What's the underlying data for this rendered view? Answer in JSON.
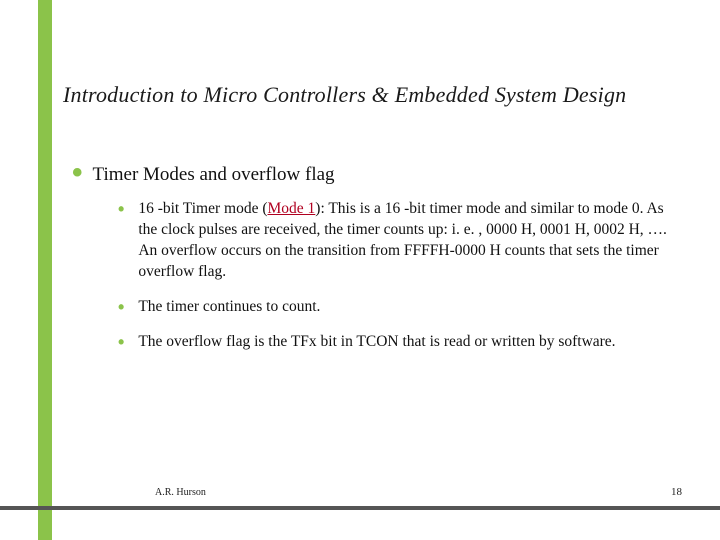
{
  "title": "Introduction to Micro Controllers & Embedded System Design",
  "main_bullet": "Timer Modes and overflow flag",
  "sub_bullets": {
    "b1_prefix": "16 -bit Timer mode (",
    "b1_mode": "Mode 1",
    "b1_suffix": "): This is a 16 -bit timer mode and similar to mode 0.  As the clock pulses are received, the timer counts up:  i. e. , 0000 H, 0001 H, 0002 H, ….  An overflow occurs on the transition from FFFFH-0000 H counts that sets the timer overflow flag.",
    "b2": "The timer continues to count.",
    "b3": "The overflow flag is the TFx bit in TCON that is read or written by software."
  },
  "footer": {
    "author": "A.R. Hurson",
    "page": "18"
  }
}
